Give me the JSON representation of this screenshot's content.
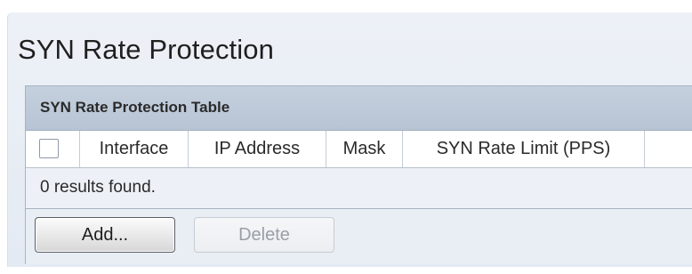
{
  "page": {
    "title": "SYN Rate Protection"
  },
  "table": {
    "caption": "SYN Rate Protection Table",
    "columns": [
      "Interface",
      "IP Address",
      "Mask",
      "SYN Rate Limit (PPS)"
    ],
    "select_all_checked": false,
    "empty_message": "0 results found.",
    "rows": []
  },
  "buttons": {
    "add_label": "Add...",
    "delete_label": "Delete",
    "delete_enabled": false
  },
  "colors": {
    "panel_background": "#edf1f7",
    "caption_background": "#c5d0de",
    "disabled_text": "#9aa0a8"
  }
}
